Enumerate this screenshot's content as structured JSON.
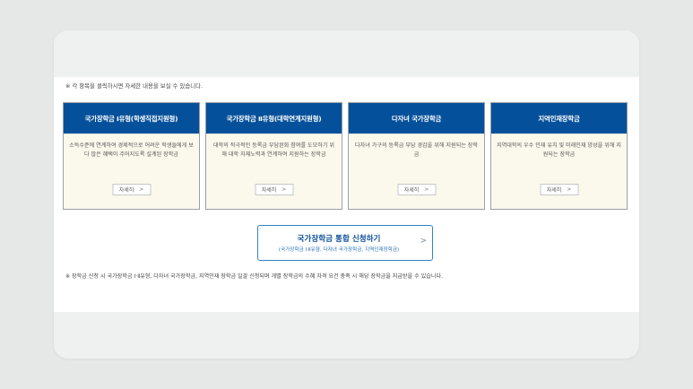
{
  "notice_top": "※ 각 항목을 클릭하시면 자세한 내용을 보실 수 있습니다.",
  "cards": [
    {
      "title": "국가장학금 Ⅰ유형(학생직접지원형)",
      "desc": "소득수준에 연계하여 경제적으로 어려운 학생들에게 보다 많은 혜택이 주어지도록 설계된 장학금",
      "button": "자세히"
    },
    {
      "title": "국가장학금 Ⅱ유형(대학연계지원형)",
      "desc": "대학의 적극적인 등록금 부담완화 참여를 도모하기 위해 대학 자체노력과 연계하여 지원하는 장학금",
      "button": "자세히"
    },
    {
      "title": "다자녀 국가장학금",
      "desc": "다자녀 가구의 등록금 부담 경감을 위해 지원되는 장학금",
      "button": "자세히"
    },
    {
      "title": "지역인재장학금",
      "desc": "지역대학의 우수 인재 유치 및 미래인재 양성을 위해 지원되는 장학금",
      "button": "자세히"
    }
  ],
  "apply": {
    "title": "국가장학금 통합 신청하기",
    "subtitle": "(국가장학금 Ⅰ·Ⅱ유형, 다자녀 국가장학금, 지역인재장학금)"
  },
  "notice_bottom": "※ 장학금 신청 시 국가장학금 Ⅰ·Ⅱ유형, 다자녀 국가장학금, 지역인재 장학금 일괄 신청되며 개별 장학금의 수혜 자격 요건 충족 시 해당 장학금을 지급받을 수 있습니다.",
  "colors": {
    "header_blue": "#05509a",
    "card_bg": "#fbf9ec",
    "apply_border": "#2e84c4"
  },
  "icons": {
    "chevron": "chevron-right-icon"
  }
}
